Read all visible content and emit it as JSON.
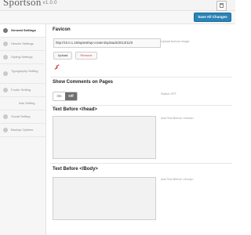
{
  "header": {
    "app_name": "Sportson",
    "version": "v1.0.0"
  },
  "toolbar": {
    "save_label": "Save All Changes"
  },
  "sidebar": {
    "items": [
      {
        "label": "General Settings",
        "icon": "gear-icon",
        "active": true
      },
      {
        "label": "Header Settings",
        "icon": "header-icon"
      },
      {
        "label": "Styling Settings",
        "icon": "brush-icon"
      },
      {
        "label": "Typography Setting",
        "icon": "typography-icon"
      },
      {
        "label": "Footer Setting",
        "icon": "footer-icon"
      },
      {
        "label": "Ads Setting",
        "icon": "ads-icon"
      },
      {
        "label": "Social Setting",
        "icon": "social-icon"
      },
      {
        "label": "Backup Options",
        "icon": "backup-icon"
      }
    ]
  },
  "favicon": {
    "title": "Favicon",
    "url_value": "http://10.0.1.16/wptest/wp-content/uploads/2013/11/0",
    "hint": "Upload favicon image",
    "upload_label": "Upload",
    "remove_label": "Remove"
  },
  "comments": {
    "title": "Show Comments on Pages",
    "on_label": "On",
    "off_label": "Off",
    "hint": "Switch OFF"
  },
  "text_before_head": {
    "title": "Text Before </head>",
    "hint": "Add Text Before </head>",
    "value": ""
  },
  "text_before_body": {
    "title": "Text Before </Body>",
    "hint": "Add Text Before </body>",
    "value": ""
  },
  "colors": {
    "accent": "#2a83b6",
    "remove": "#d04a3c"
  }
}
